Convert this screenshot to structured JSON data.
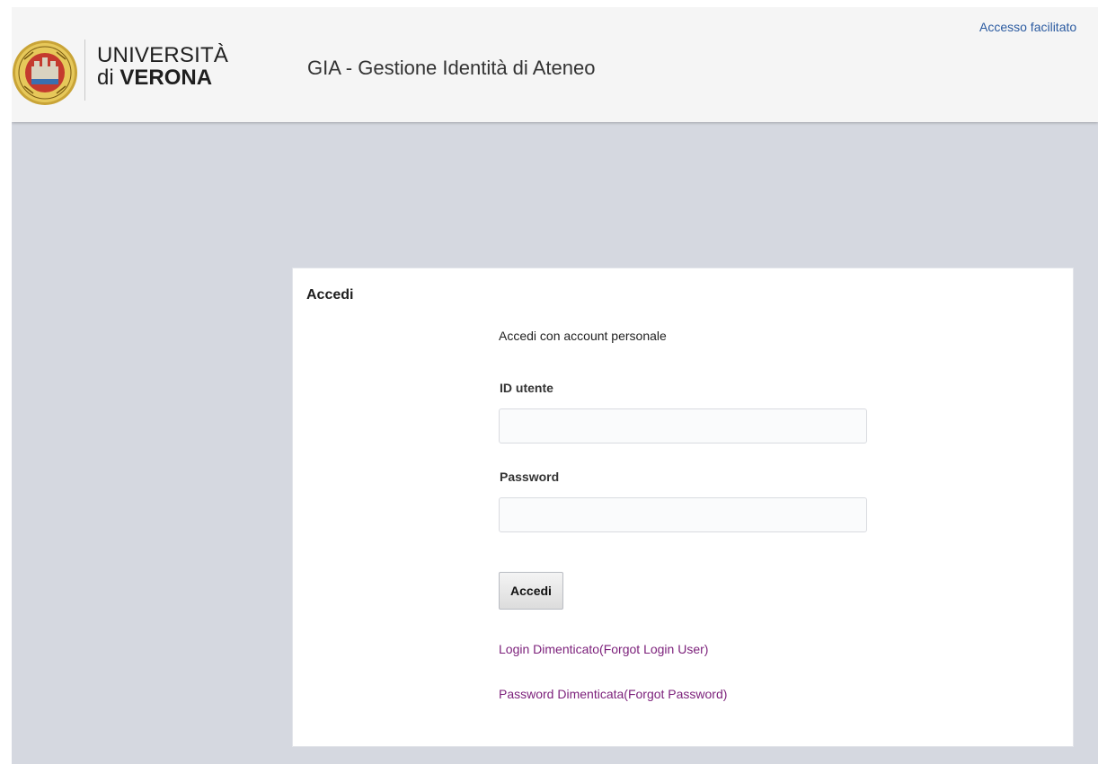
{
  "header": {
    "university_line1": "UNIVERSITÀ",
    "university_line2_prefix": "di ",
    "university_line2_bold": "VERONA",
    "app_title": "GIA - Gestione Identità di Ateneo",
    "accessibility_link": "Accesso facilitato"
  },
  "login": {
    "title": "Accedi",
    "intro": "Accedi con account personale",
    "user_label": "ID utente",
    "user_value": "",
    "password_label": "Password",
    "password_value": "",
    "submit_label": "Accedi",
    "forgot_login": "Login Dimenticato(Forgot Login User)",
    "forgot_password": "Password Dimenticata(Forgot Password)"
  },
  "icons": {
    "logo": "university-seal-icon"
  },
  "colors": {
    "page_background": "#d5d8e0",
    "header_background": "#f5f5f5",
    "link_purple": "#7b1f7a",
    "link_blue": "#2a5aa0"
  }
}
